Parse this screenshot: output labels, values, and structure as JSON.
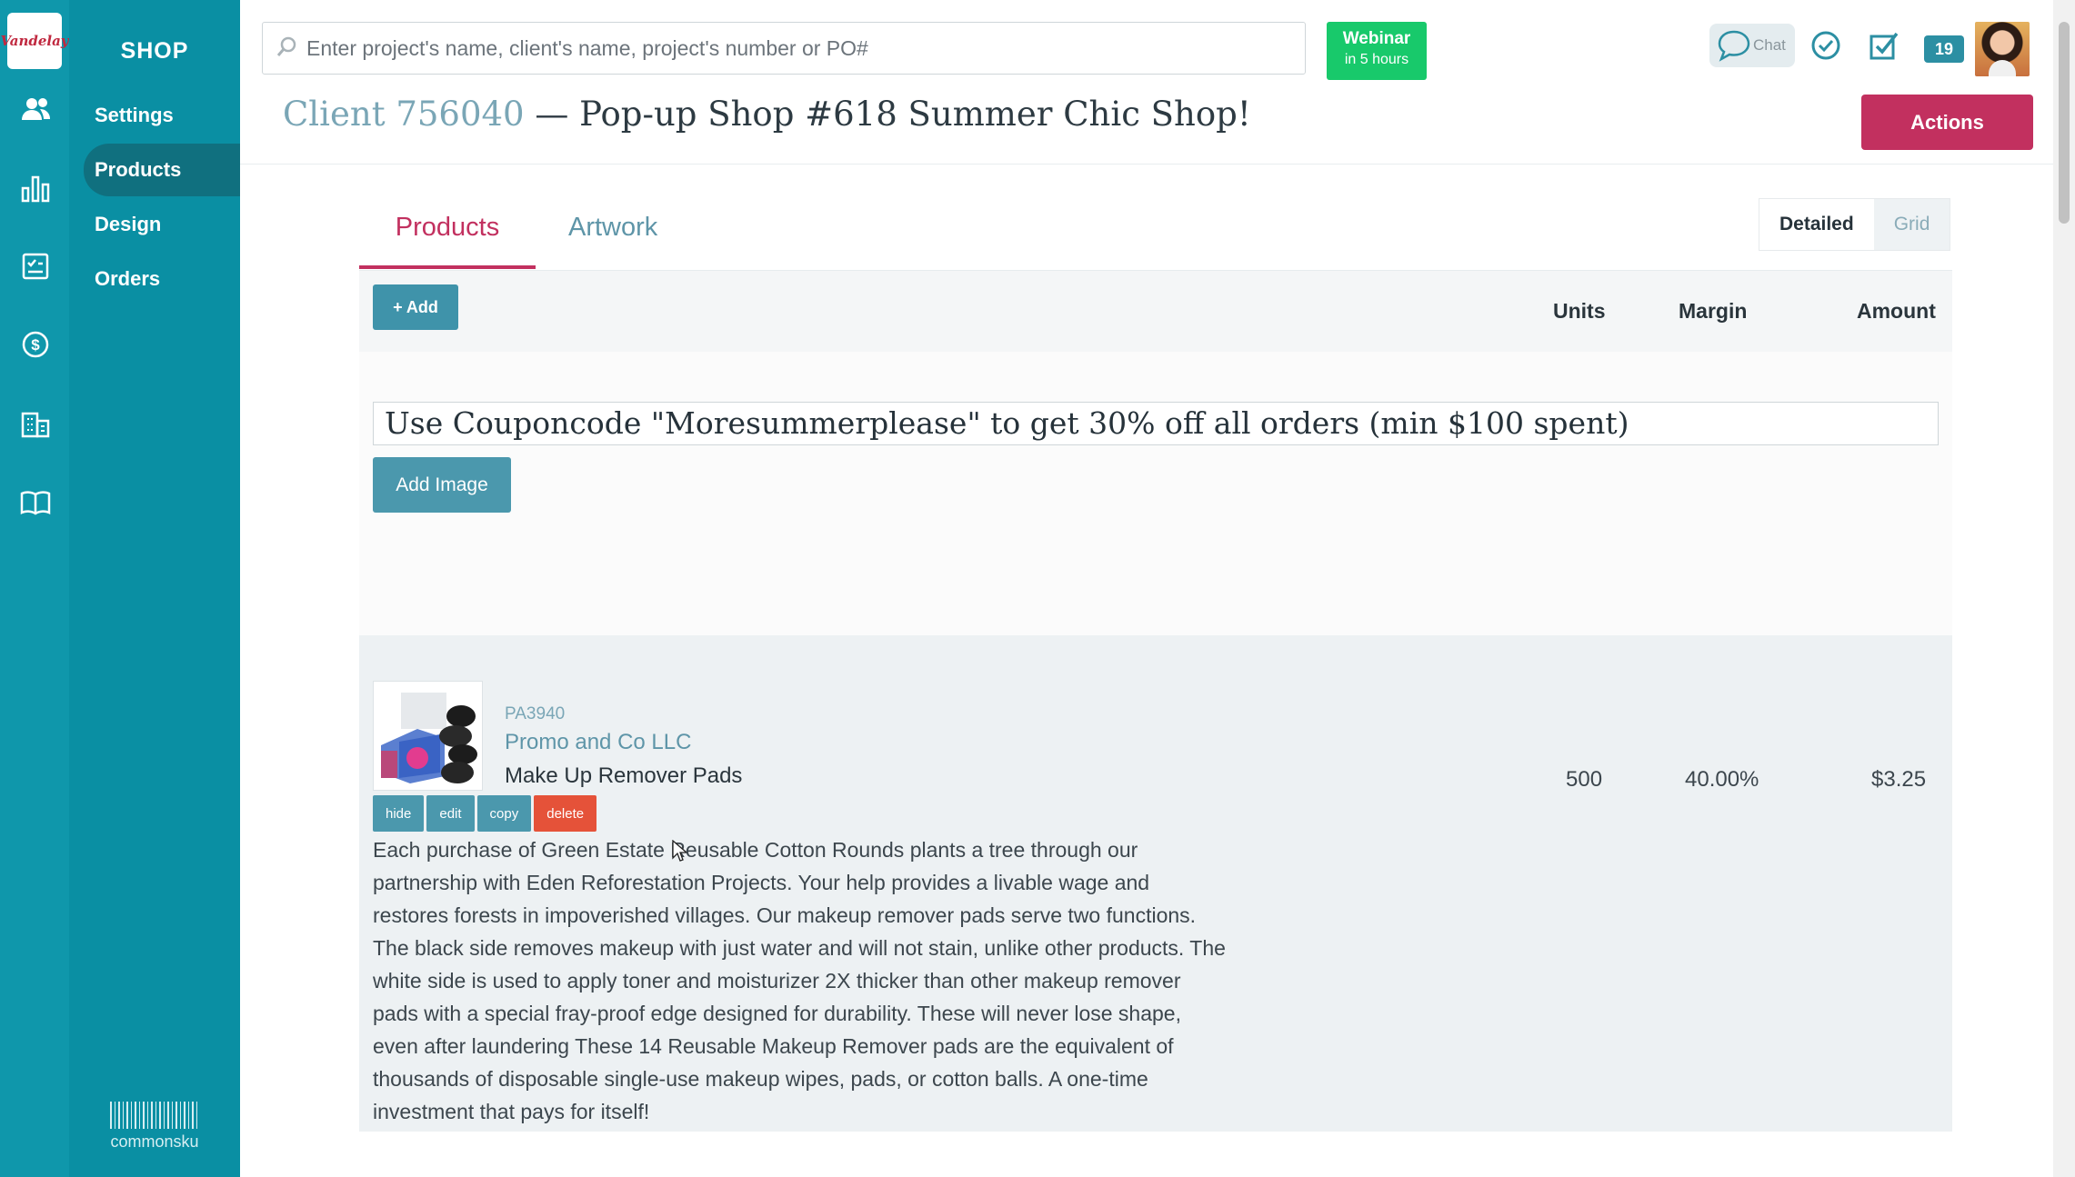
{
  "nav": {
    "brand_logo_text": "Vandelay",
    "section_title": "SHOP",
    "items": [
      {
        "label": "Settings"
      },
      {
        "label": "Products"
      },
      {
        "label": "Design"
      },
      {
        "label": "Orders"
      }
    ],
    "footer_brand": "commonsku"
  },
  "header": {
    "search_placeholder": "Enter project's name, client's name, project's number or PO#",
    "webinar_title": "Webinar",
    "webinar_sub": "in 5 hours",
    "chat_label": "Chat",
    "notification_count": "19"
  },
  "page": {
    "client": "Client 756040",
    "separator": " — ",
    "project": "Pop-up Shop #618 Summer Chic Shop!",
    "actions_label": "Actions"
  },
  "tabs": {
    "products": "Products",
    "artwork": "Artwork"
  },
  "view_toggle": {
    "detailed": "Detailed",
    "grid": "Grid"
  },
  "table": {
    "add_label": "+ Add",
    "columns": {
      "units": "Units",
      "margin": "Margin",
      "amount": "Amount"
    }
  },
  "section": {
    "coupon_text": "Use Couponcode \"Moresummerplease\" to get 30% off all orders (min $100 spent)",
    "add_image_label": "Add Image"
  },
  "product": {
    "sku": "PA3940",
    "supplier": "Promo and Co LLC",
    "name": "Make Up Remover Pads",
    "units": "500",
    "margin": "40.00%",
    "amount": "$3.25",
    "buttons": {
      "hide": "hide",
      "edit": "edit",
      "copy": "copy",
      "delete": "delete"
    },
    "description": "Each purchase of Green Estate Reusable Cotton Rounds plants a tree through our partnership with Eden Reforestation Projects. Your help provides a livable wage and restores forests in impoverished villages. Our makeup remover pads serve two functions. The black side removes makeup with just water and will not stain, unlike other products. The white side is used to apply toner and moisturizer 2X thicker than other makeup remover pads with a special fray-proof edge designed for durability. These will never lose shape, even after laundering These 14 Reusable Makeup Remover pads are the equivalent of thousands of disposable single-use makeup wipes, pads, or cotton balls. A one-time investment that pays for itself!"
  },
  "colors": {
    "rail": "#0f97ab",
    "accent": "#c2305f",
    "webinar": "#18c96b",
    "button": "#4b98ad",
    "danger": "#e55239"
  }
}
